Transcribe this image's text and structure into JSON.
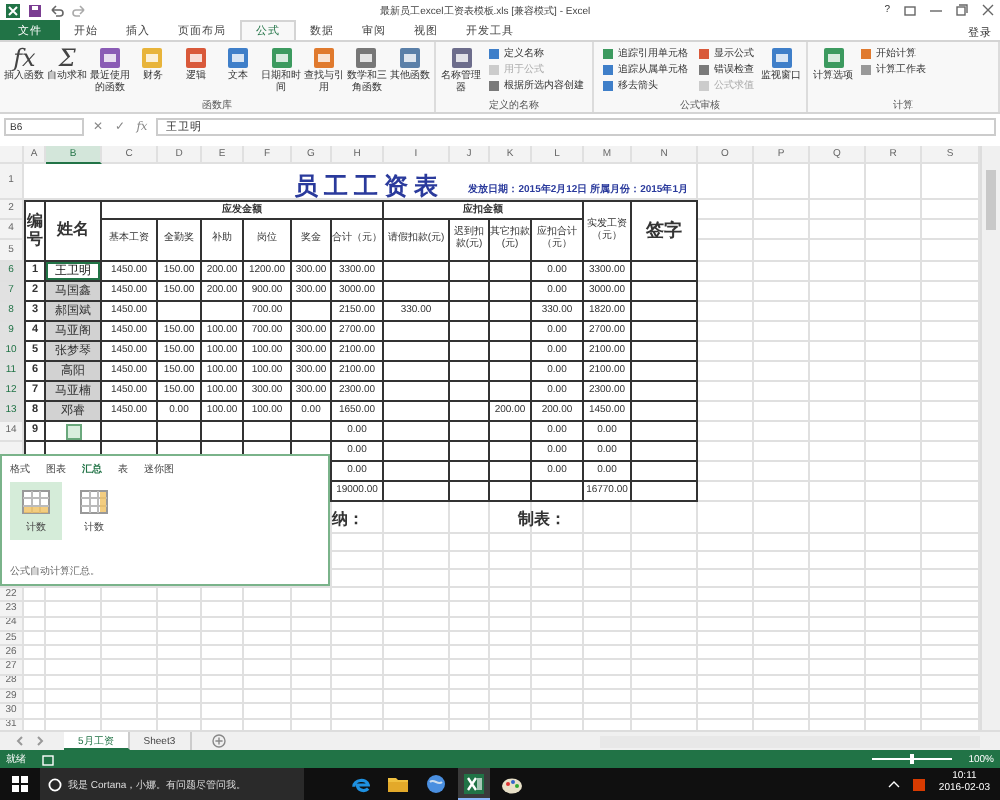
{
  "title_bar": {
    "title": "最新员工excel工资表模板.xls [兼容模式] - Excel",
    "help": "?"
  },
  "ribbon": {
    "tabs": [
      {
        "label": "文件",
        "kind": "file",
        "selected": false
      },
      {
        "label": "开始",
        "kind": "tab",
        "selected": false
      },
      {
        "label": "插入",
        "kind": "tab",
        "selected": false
      },
      {
        "label": "页面布局",
        "kind": "tab",
        "selected": false
      },
      {
        "label": "公式",
        "kind": "tab",
        "selected": true
      },
      {
        "label": "数据",
        "kind": "tab",
        "selected": false
      },
      {
        "label": "审阅",
        "kind": "tab",
        "selected": false
      },
      {
        "label": "视图",
        "kind": "tab",
        "selected": false
      },
      {
        "label": "开发工具",
        "kind": "tab",
        "selected": false
      }
    ],
    "sign_in": "登录",
    "groups": [
      {
        "label": "函数库",
        "items": [
          {
            "kind": "large",
            "glyph": "fx",
            "label": "插入函数",
            "disabled": false
          },
          {
            "kind": "large",
            "glyph": "Σ",
            "label": "自动求和",
            "disabled": false
          },
          {
            "kind": "large",
            "label": "最近使用的函数",
            "disabled": false
          },
          {
            "kind": "large",
            "label": "财务",
            "disabled": false
          },
          {
            "kind": "large",
            "label": "逻辑",
            "disabled": false
          },
          {
            "kind": "large",
            "label": "文本",
            "disabled": false
          },
          {
            "kind": "large",
            "label": "日期和时间",
            "disabled": false
          },
          {
            "kind": "large",
            "label": "查找与引用",
            "disabled": false
          },
          {
            "kind": "large",
            "label": "数学和三角函数",
            "disabled": false
          },
          {
            "kind": "large",
            "label": "其他函数",
            "disabled": false
          }
        ]
      },
      {
        "label": "定义的名称",
        "items": [
          {
            "kind": "large",
            "label": "名称管理器",
            "disabled": false
          },
          {
            "kind": "stack",
            "items": [
              {
                "label": "定义名称",
                "disabled": false
              },
              {
                "label": "用于公式",
                "disabled": true
              },
              {
                "label": "根据所选内容创建",
                "disabled": false
              }
            ]
          }
        ]
      },
      {
        "label": "公式审核",
        "items": [
          {
            "kind": "stack",
            "items": [
              {
                "label": "追踪引用单元格",
                "disabled": false
              },
              {
                "label": "追踪从属单元格",
                "disabled": false
              },
              {
                "label": "移去箭头",
                "disabled": false
              }
            ]
          },
          {
            "kind": "stack",
            "items": [
              {
                "label": "显示公式",
                "disabled": false
              },
              {
                "label": "错误检查",
                "disabled": false
              },
              {
                "label": "公式求值",
                "disabled": true
              }
            ]
          },
          {
            "kind": "large",
            "label": "监视窗口",
            "disabled": false
          }
        ]
      },
      {
        "label": "计算",
        "items": [
          {
            "kind": "large",
            "label": "计算选项",
            "disabled": false
          },
          {
            "kind": "stack",
            "items": [
              {
                "label": "开始计算",
                "disabled": false
              },
              {
                "label": "计算工作表",
                "disabled": false
              }
            ]
          }
        ]
      }
    ]
  },
  "formula_bar": {
    "name_box": "B6",
    "buttons": [
      "✕",
      "✓",
      "fx"
    ],
    "formula": "王卫明"
  },
  "sheet": {
    "columns": [
      {
        "label": "A",
        "selected": false
      },
      {
        "label": "B",
        "selected": true
      },
      {
        "label": "C",
        "selected": false
      },
      {
        "label": "D",
        "selected": false
      },
      {
        "label": "E",
        "selected": false
      },
      {
        "label": "F",
        "selected": false
      },
      {
        "label": "G",
        "selected": false
      },
      {
        "label": "H",
        "selected": false
      },
      {
        "label": "I",
        "selected": false
      },
      {
        "label": "J",
        "selected": false
      },
      {
        "label": "K",
        "selected": false
      },
      {
        "label": "L",
        "selected": false
      },
      {
        "label": "M",
        "selected": false
      },
      {
        "label": "N",
        "selected": false
      },
      {
        "label": "O",
        "selected": false
      },
      {
        "label": "P",
        "selected": false
      },
      {
        "label": "Q",
        "selected": false
      },
      {
        "label": "R",
        "selected": false
      },
      {
        "label": "S",
        "selected": false
      }
    ],
    "title_row": {
      "row_number": "1",
      "title": "员工工资表",
      "date_info": "发放日期：2015年2月12日  所属月份：2015年1月"
    },
    "header": {
      "row_numbers": [
        "2",
        "4",
        "5"
      ],
      "id": "编号",
      "name": "姓名",
      "payable": "应发金额",
      "payable_items": [
        "基本工资",
        "全勤奖",
        "补助",
        "岗位",
        "奖金",
        "合计（元）"
      ],
      "deduction": "应扣金额",
      "deduction_items": [
        "请假扣款(元)",
        "迟到扣款(元)",
        "其它扣款(元)",
        "应扣合计（元）"
      ],
      "net_pay": "实发工资（元）",
      "signature": "签字"
    },
    "rows": [
      {
        "kind": "data",
        "row_number": "6",
        "selected": true,
        "cells": {
          "A": "1",
          "B": "王卫明",
          "C": "1450.00",
          "D": "150.00",
          "E": "200.00",
          "F": "1200.00",
          "G": "300.00",
          "H": "3300.00",
          "L": "0.00",
          "M": "3300.00"
        }
      },
      {
        "kind": "data",
        "row_number": "7",
        "selected": true,
        "cells": {
          "A": "2",
          "B": "马国鑫",
          "C": "1450.00",
          "D": "150.00",
          "E": "200.00",
          "F": "900.00",
          "G": "300.00",
          "H": "3000.00",
          "L": "0.00",
          "M": "3000.00"
        }
      },
      {
        "kind": "data",
        "row_number": "8",
        "selected": true,
        "cells": {
          "A": "3",
          "B": "郝国斌",
          "C": "1450.00",
          "F": "700.00",
          "H": "2150.00",
          "I": "330.00",
          "L": "330.00",
          "M": "1820.00"
        }
      },
      {
        "kind": "data",
        "row_number": "9",
        "selected": true,
        "cells": {
          "A": "4",
          "B": "马亚阁",
          "C": "1450.00",
          "D": "150.00",
          "E": "100.00",
          "F": "700.00",
          "G": "300.00",
          "H": "2700.00",
          "L": "0.00",
          "M": "2700.00"
        }
      },
      {
        "kind": "data",
        "row_number": "10",
        "selected": true,
        "cells": {
          "A": "5",
          "B": "张梦琴",
          "C": "1450.00",
          "D": "150.00",
          "E": "100.00",
          "F": "100.00",
          "G": "300.00",
          "H": "2100.00",
          "L": "0.00",
          "M": "2100.00"
        }
      },
      {
        "kind": "data",
        "row_number": "11",
        "selected": true,
        "cells": {
          "A": "6",
          "B": "高阳",
          "C": "1450.00",
          "D": "150.00",
          "E": "100.00",
          "F": "100.00",
          "G": "300.00",
          "H": "2100.00",
          "L": "0.00",
          "M": "2100.00"
        }
      },
      {
        "kind": "data",
        "row_number": "12",
        "selected": true,
        "cells": {
          "A": "7",
          "B": "马亚楠",
          "C": "1450.00",
          "D": "150.00",
          "E": "100.00",
          "F": "300.00",
          "G": "300.00",
          "H": "2300.00",
          "L": "0.00",
          "M": "2300.00"
        }
      },
      {
        "kind": "data",
        "row_number": "13",
        "selected": true,
        "cells": {
          "A": "8",
          "B": "邓睿",
          "C": "1450.00",
          "D": "0.00",
          "E": "100.00",
          "F": "100.00",
          "G": "0.00",
          "H": "1650.00",
          "K": "200.00",
          "L": "200.00",
          "M": "1450.00"
        }
      },
      {
        "kind": "data",
        "row_number": "14",
        "selected": false,
        "cells": {
          "A": "9",
          "H": "0.00",
          "L": "0.00",
          "M": "0.00"
        }
      },
      {
        "kind": "data",
        "cells": {
          "H": "0.00",
          "L": "0.00",
          "M": "0.00"
        }
      },
      {
        "kind": "data",
        "cells": {
          "H": "0.00",
          "L": "0.00",
          "M": "0.00"
        }
      },
      {
        "kind": "data",
        "cells": {
          "H": "19000.00",
          "M": "16770.00"
        }
      },
      {
        "kind": "signature",
        "cells": {
          "H": "纳：",
          "K": "制表："
        }
      }
    ],
    "more_row_numbers": [
      "22",
      "23",
      "24",
      "25",
      "26",
      "27",
      "28",
      "29",
      "30",
      "31"
    ]
  },
  "quick_analysis": {
    "tabs": [
      {
        "label": "格式",
        "selected": false
      },
      {
        "label": "图表",
        "selected": false
      },
      {
        "label": "汇总",
        "selected": true
      },
      {
        "label": "表",
        "selected": false
      },
      {
        "label": "迷你图",
        "selected": false
      }
    ],
    "options": [
      {
        "label": "计数",
        "selected": true
      },
      {
        "label": "计数",
        "selected": false
      }
    ],
    "description": "公式自动计算汇总。"
  },
  "sheet_tabs": [
    {
      "label": "5月工资",
      "selected": true
    },
    {
      "label": "Sheet3",
      "selected": false
    }
  ],
  "status_bar": {
    "status": "就绪",
    "zoom_slider": {
      "level": 0.5
    },
    "zoom": "100%"
  },
  "taskbar": {
    "search_placeholder": "我是 Cortana，小娜。有问题尽管问我。",
    "apps": [
      {
        "kind": "swirl",
        "active": false
      },
      {
        "kind": "folder",
        "active": false
      },
      {
        "kind": "globe",
        "active": false
      },
      {
        "kind": "sheet",
        "active": true
      },
      {
        "kind": "palette",
        "active": false
      }
    ],
    "time": "10:11",
    "date": "2016-02-03"
  }
}
